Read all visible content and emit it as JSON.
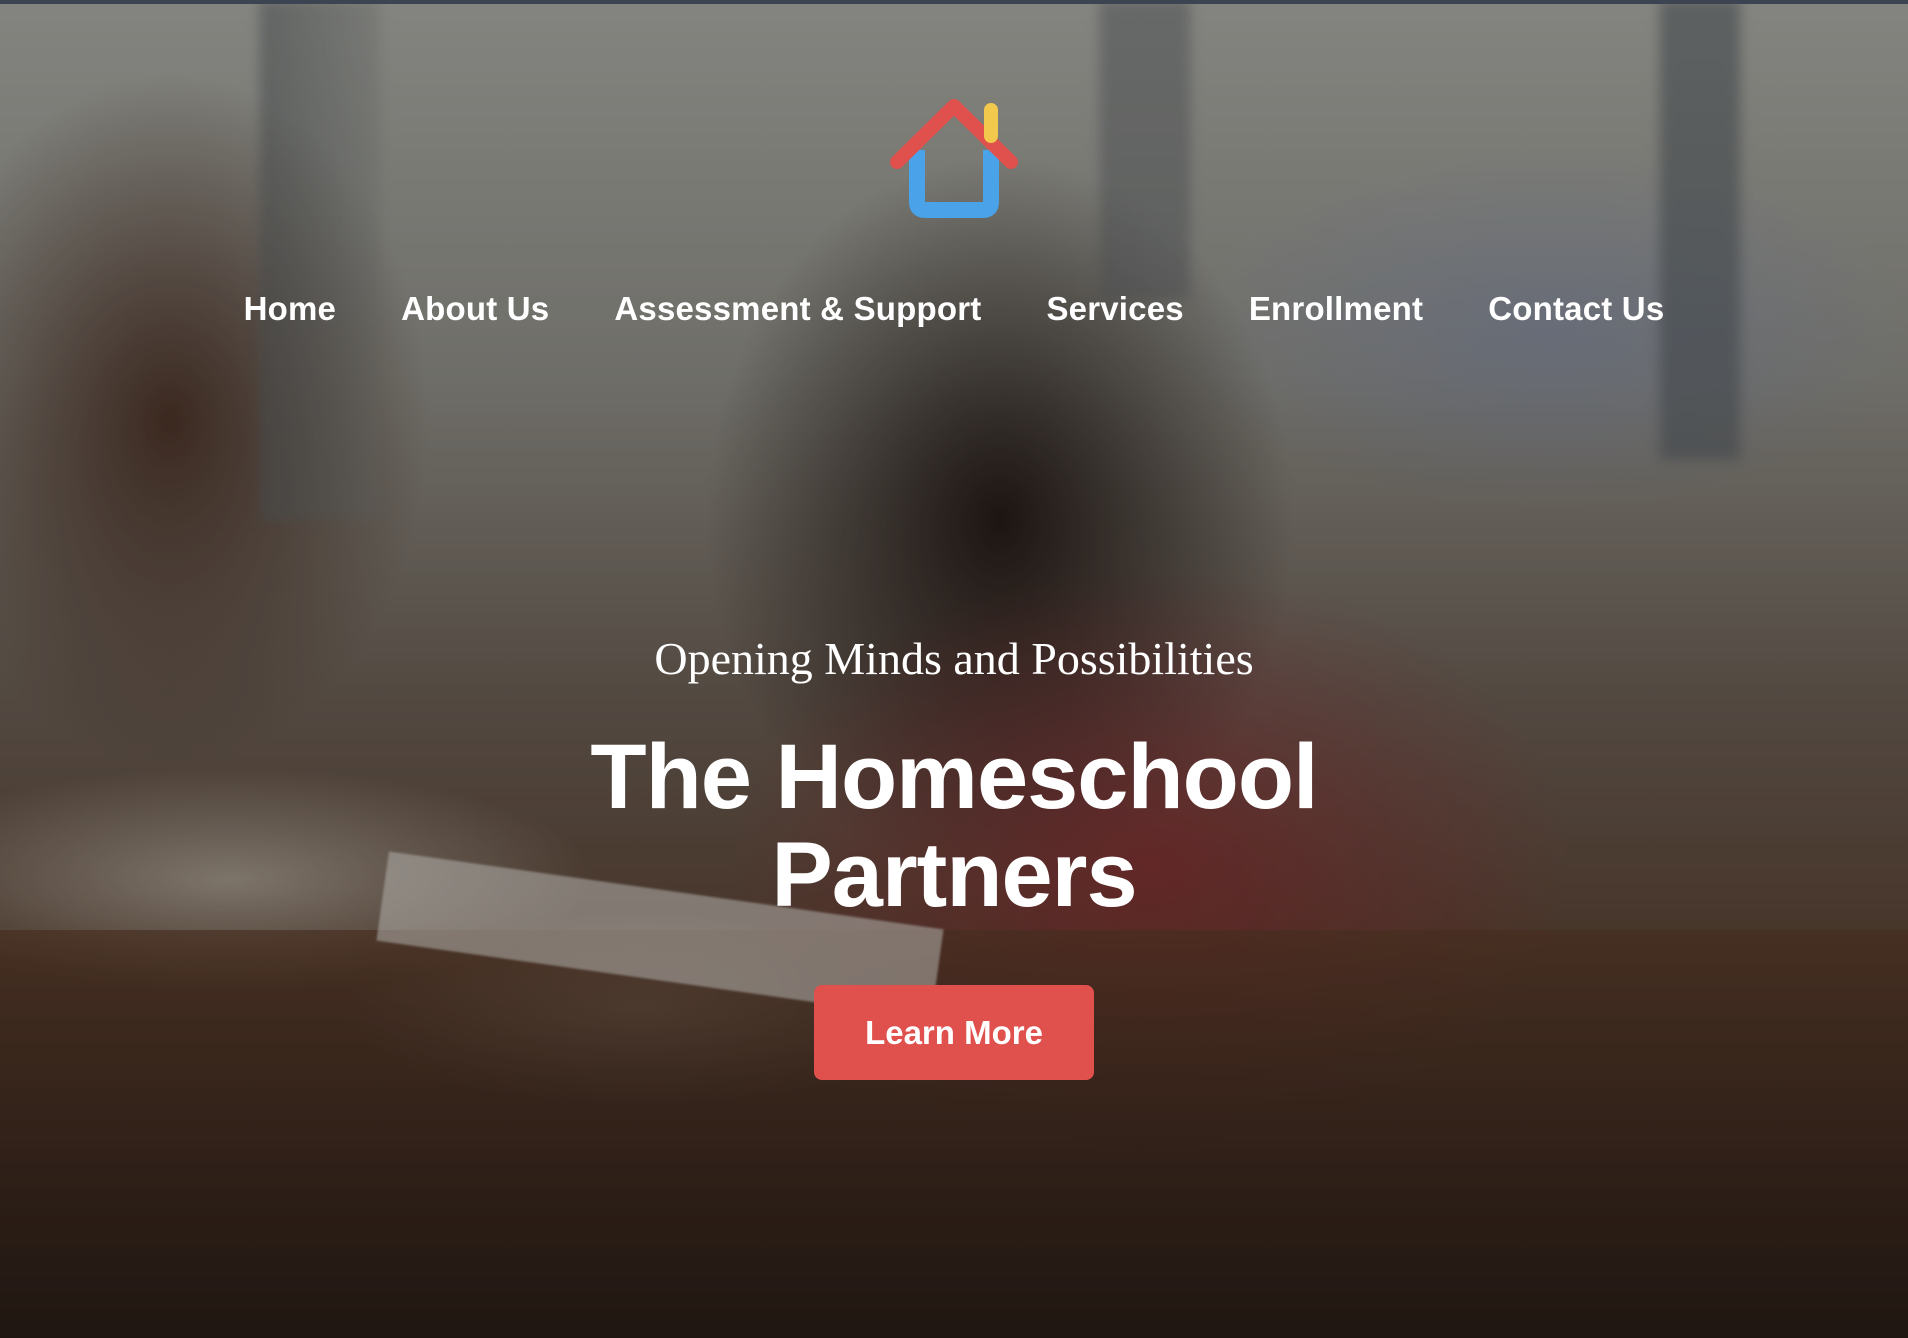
{
  "brand": {
    "logo_icon": "house-logo-icon",
    "colors": {
      "roof": "#e0504d",
      "chimney": "#f2c94c",
      "walls": "#4aa3e8"
    }
  },
  "nav": {
    "items": [
      {
        "label": "Home"
      },
      {
        "label": "About Us"
      },
      {
        "label": "Assessment & Support"
      },
      {
        "label": "Services"
      },
      {
        "label": "Enrollment"
      },
      {
        "label": "Contact Us"
      }
    ]
  },
  "hero": {
    "tagline": "Opening Minds and Possibilities",
    "title_line1": "The Homeschool",
    "title_line2": "Partners",
    "cta_label": "Learn More",
    "cta_color": "#e0504d"
  }
}
